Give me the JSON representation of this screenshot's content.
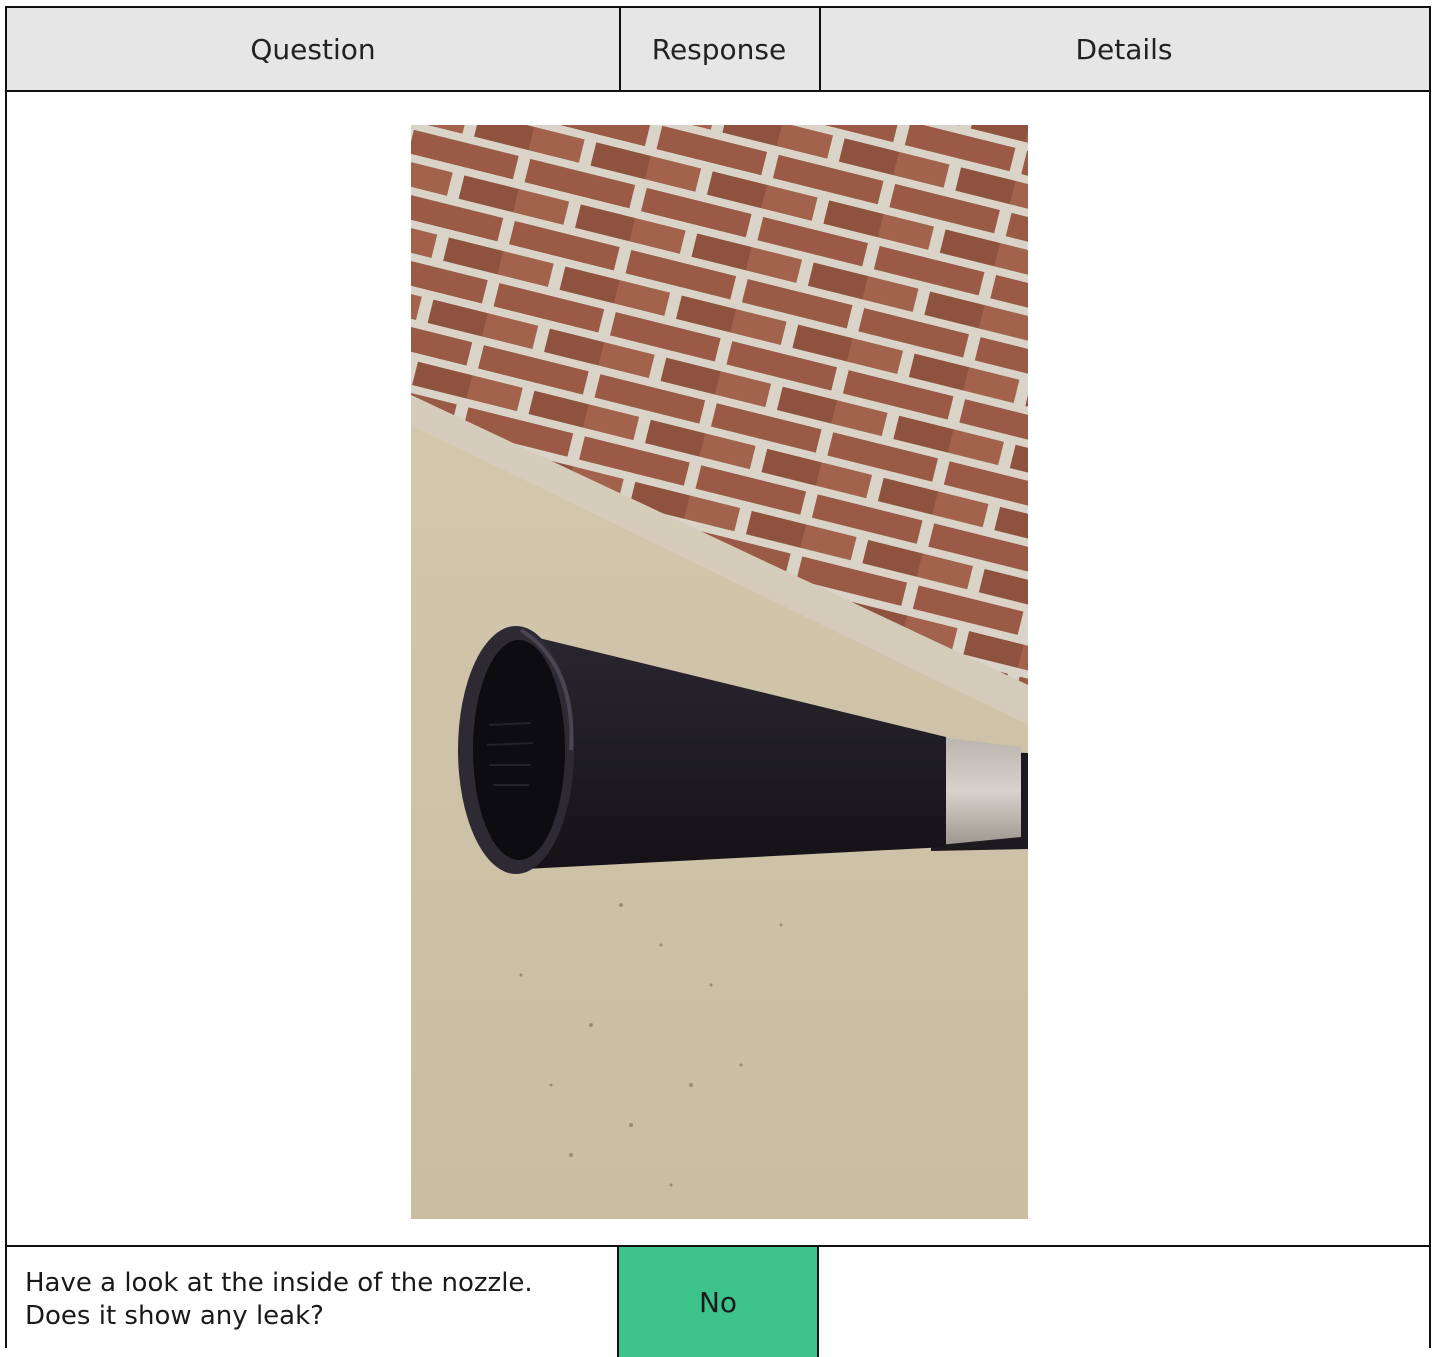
{
  "header": {
    "question": "Question",
    "response": "Response",
    "details": "Details"
  },
  "photo": {
    "subject": "photo of black nozzle pipe in front of brick wall"
  },
  "items": [
    {
      "question_line1": "Have a look at the inside of the nozzle.",
      "question_line2": "Does it show any leak?",
      "response": "No",
      "response_color": "#3dc48d",
      "details": ""
    }
  ]
}
